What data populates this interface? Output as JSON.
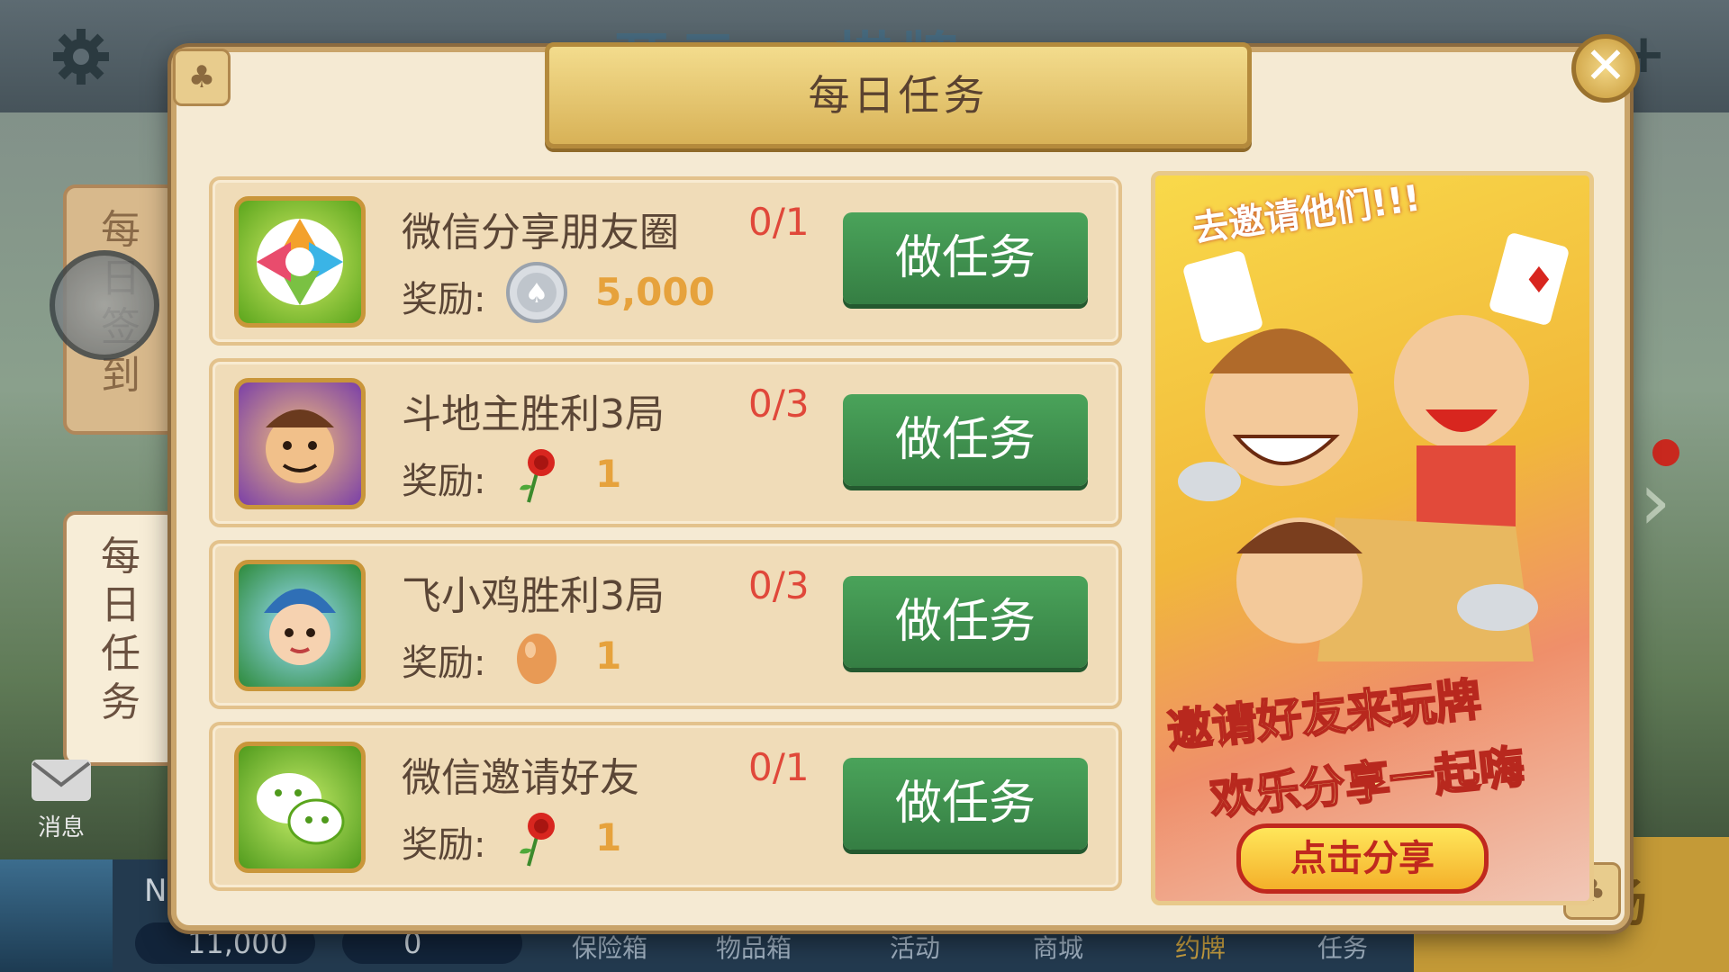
{
  "background": {
    "title_partial": "开元 · 棋牌",
    "side_tabs": [
      "每日签到",
      "每日任务"
    ],
    "message_label": "消息",
    "bottom": {
      "coins": "11,000",
      "gold": "0",
      "nav": [
        "保险箱",
        "物品箱",
        "活动",
        "商城",
        "约牌",
        "任务"
      ],
      "arena_label": "比赛场",
      "name_initial": "N"
    }
  },
  "modal": {
    "title": "每日任务",
    "close_glyph": "✕",
    "corner_glyph": "♣",
    "tasks": [
      {
        "name": "微信分享朋友圈",
        "progress": "0/1",
        "reward_label": "奖励:",
        "reward_icon": "silver-coin-icon",
        "reward_amount": "5,000",
        "button": "做任务"
      },
      {
        "name": "斗地主胜利3局",
        "progress": "0/3",
        "reward_label": "奖励:",
        "reward_icon": "rose-icon",
        "reward_amount": "1",
        "button": "做任务"
      },
      {
        "name": "飞小鸡胜利3局",
        "progress": "0/3",
        "reward_label": "奖励:",
        "reward_icon": "egg-icon",
        "reward_amount": "1",
        "button": "做任务"
      },
      {
        "name": "微信邀请好友",
        "progress": "0/1",
        "reward_label": "奖励:",
        "reward_icon": "rose-icon",
        "reward_amount": "1",
        "button": "做任务"
      }
    ],
    "ad": {
      "top_text": "去邀请他们!!!",
      "line1": "邀请好友来玩牌",
      "line2": "欢乐分享一起嗨",
      "button": "点击分享"
    }
  },
  "colors": {
    "accent_green": "#3f9350",
    "progress_red": "#e0483a",
    "reward_gold": "#e6a23c"
  }
}
